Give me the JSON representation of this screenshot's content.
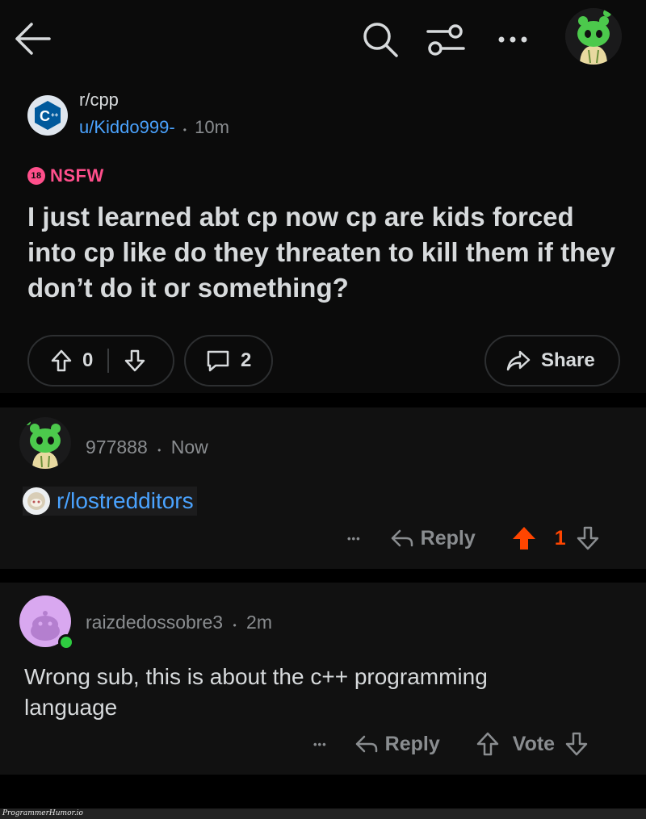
{
  "post": {
    "subreddit": "r/cpp",
    "author": "u/Kiddo999-",
    "separator": "•",
    "time": "10m",
    "nsfw_badge": "18",
    "nsfw_label": "NSFW",
    "title": "I just learned abt cp now cp are kids forced into cp like do they threaten to kill them if they don’t do it or something?",
    "score": "0",
    "comments": "2",
    "share_label": "Share"
  },
  "comments": [
    {
      "author": "977888",
      "time": "Now",
      "link_text": "r/lostredditors",
      "more": "•••",
      "reply_label": "Reply",
      "score": "1",
      "upvoted": true
    },
    {
      "author": "raizdedossobre3",
      "time": "2m",
      "body": "Wrong sub, this is about the c++ programming language",
      "more": "•••",
      "reply_label": "Reply",
      "vote_label": "Vote"
    }
  ],
  "watermark": "ProgrammerHumor.io",
  "colors": {
    "background": "#0b0b0b",
    "link_blue": "#4aa3ff",
    "nsfw_pink": "#ff4f8b",
    "upvote_orange": "#ff4500",
    "online_green": "#2ecc40"
  }
}
